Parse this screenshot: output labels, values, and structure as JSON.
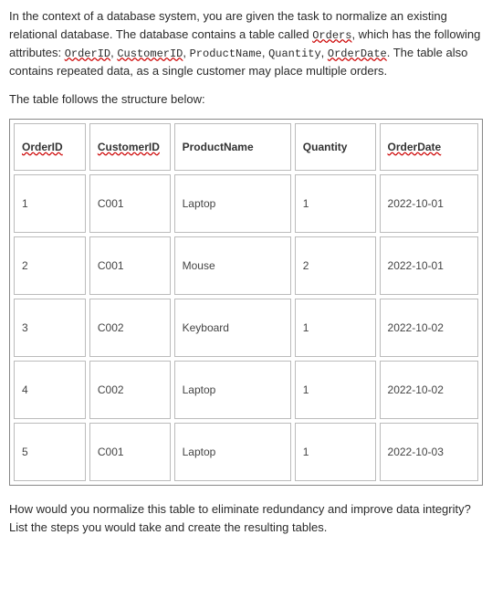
{
  "intro": {
    "p1_a": "In the context of a database system, you are given the task to normalize an existing relational database. The database contains a table called ",
    "table_name": "Orders",
    "p1_b": ", which has the following attributes: ",
    "attr1": "OrderID",
    "sep1": ", ",
    "attr2": "CustomerID",
    "sep2": ", ",
    "attr3": "ProductName",
    "sep3": ", ",
    "attr4": "Quantity",
    "sep4": ", ",
    "attr5": "OrderDate",
    "p1_c": ". The table also contains repeated data, as a single customer may place multiple orders.",
    "structure": "The table follows the structure below:"
  },
  "table": {
    "headers": {
      "h1": "OrderID",
      "h2": "CustomerID",
      "h3": "ProductName",
      "h4": "Quantity",
      "h5": "OrderDate"
    },
    "rows": [
      {
        "c1": "1",
        "c2": "C001",
        "c3": "Laptop",
        "c4": "1",
        "c5": "2022-10-01"
      },
      {
        "c1": "2",
        "c2": "C001",
        "c3": "Mouse",
        "c4": "2",
        "c5": "2022-10-01"
      },
      {
        "c1": "3",
        "c2": "C002",
        "c3": "Keyboard",
        "c4": "1",
        "c5": "2022-10-02"
      },
      {
        "c1": "4",
        "c2": "C002",
        "c3": "Laptop",
        "c4": "1",
        "c5": "2022-10-02"
      },
      {
        "c1": "5",
        "c2": "C001",
        "c3": "Laptop",
        "c4": "1",
        "c5": "2022-10-03"
      }
    ]
  },
  "question": "How would you normalize this table to eliminate redundancy and improve data integrity? List the steps you would take and create the resulting tables."
}
